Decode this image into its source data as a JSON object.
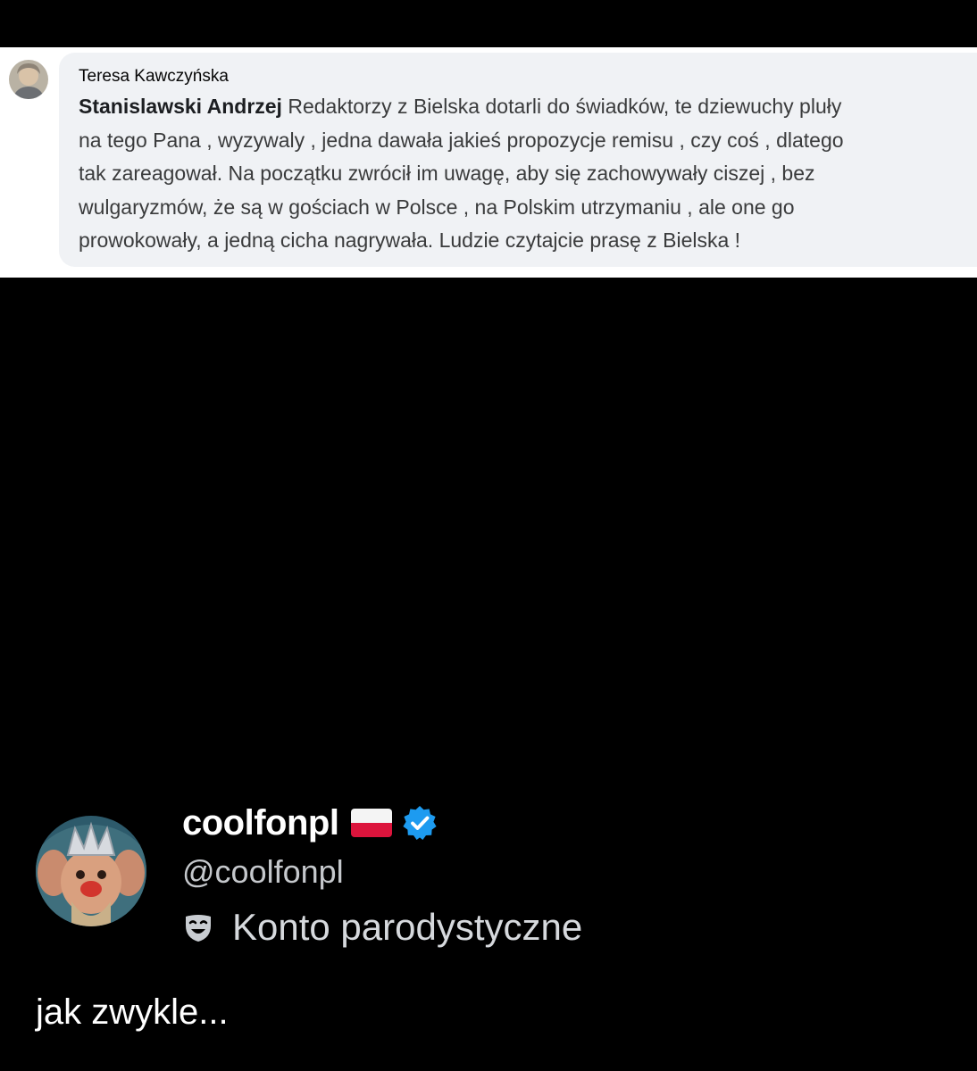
{
  "facebook_comment": {
    "author": "Teresa Kawczyńska",
    "mention": "Stanislawski Andrzej",
    "lines": [
      "Redaktorzy z Bielska dotarli do świadków, te dziewuchy pluły",
      "na tego Pana , wyzywaly , jedna dawała jakieś propozycje remisu , czy coś , dlatego",
      "tak zareagował. Na początku zwrócił im uwagę, aby się zachowywały ciszej , bez",
      "wulgaryzmów, że są w gościach w Polsce , na Polskim utrzymaniu , ale one go",
      "prowokowały, a jedną cicha nagrywała. Ludzie czytajcie prasę z Bielska !"
    ]
  },
  "tweet": {
    "display_name": "coolfonpl",
    "flag_icon": "poland-flag-icon",
    "verified_icon": "verified-badge-icon",
    "verified_color": "#1d9bf0",
    "handle": "@coolfonpl",
    "label_icon": "parody-mask-icon",
    "label": "Konto parodystyczne",
    "text": "jak zwykle..."
  }
}
